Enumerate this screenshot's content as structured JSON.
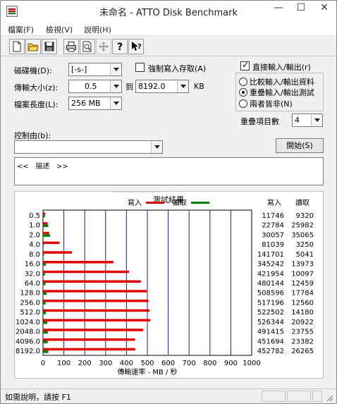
{
  "window": {
    "title": "未命名 - ATTO Disk Benchmark"
  },
  "menu": [
    "檔案(F)",
    "檢視(V)",
    "說明(H)"
  ],
  "toolbar": [
    "new-icon",
    "open-icon",
    "save-icon",
    "print-icon",
    "print-preview-icon",
    "move-icon",
    "help-icon",
    "context-help-icon"
  ],
  "form": {
    "drive_label": "磁碟機(D):",
    "drive_value": "[-s-]",
    "transfer_label": "傳輸大小(z):",
    "transfer_from": "0.5",
    "to_label": "到",
    "transfer_to": "8192.0",
    "kb_label": "KB",
    "length_label": "檔案長度(L):",
    "length_value": "256 MB",
    "force_write_label": "強制寫入存取(A)",
    "direct_io_label": "直接輸入/輸出(r)",
    "radio_compare": "比較輸入/輸出資料",
    "radio_overlap": "重疊輸入/輸出測試",
    "radio_neither": "兩者皆非(N)",
    "queue_label": "重疊項目數",
    "queue_value": "4",
    "controlled_label": "控制由(b):",
    "start_button": "開始(S)",
    "description_text": "<<   描述   >>"
  },
  "results": {
    "title": "測試結果",
    "legend_write": "寫入",
    "legend_read": "讀取",
    "col_write": "寫入",
    "col_read": "讀取",
    "write_color": "#e00000",
    "read_color": "#008000"
  },
  "chart_data": {
    "type": "bar",
    "orientation": "horizontal",
    "xlabel": "傳輸速率 - MB / 秒",
    "xlim": [
      0,
      1000
    ],
    "x_ticks": [
      0,
      100,
      200,
      300,
      400,
      500,
      600,
      700,
      800,
      900,
      1000
    ],
    "categories": [
      "0.5",
      "1.0",
      "2.0",
      "4.0",
      "8.0",
      "16.0",
      "32.0",
      "64.0",
      "128.0",
      "256.0",
      "512.0",
      "1024.0",
      "2048.0",
      "4096.0",
      "8192.0"
    ],
    "series": [
      {
        "name": "寫入",
        "values": [
          11746,
          22784,
          30057,
          81039,
          141701,
          345242,
          421954,
          480144,
          508596,
          517196,
          522502,
          526344,
          491415,
          451694,
          452782
        ]
      },
      {
        "name": "讀取",
        "values": [
          9320,
          25982,
          35065,
          3250,
          5041,
          13973,
          10097,
          12459,
          17784,
          12560,
          14180,
          20922,
          23755,
          23382,
          26265
        ]
      }
    ]
  },
  "status": {
    "text": "如需說明，請按 F1"
  }
}
